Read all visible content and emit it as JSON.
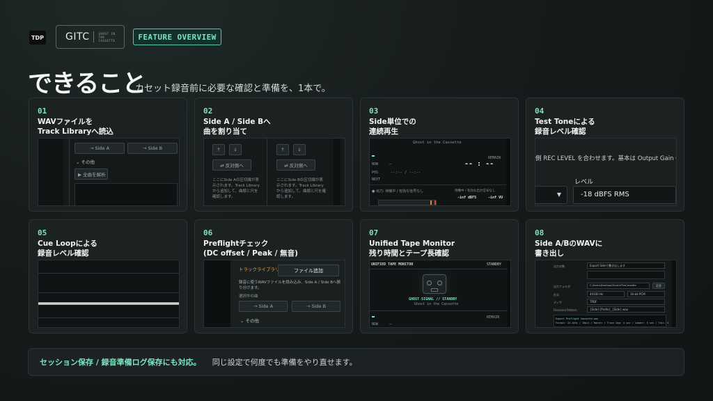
{
  "header": {
    "tdp": "TDP",
    "logo_name": "GITC",
    "logo_sub": "GHOST IN THE CASSETTE",
    "badge": "FEATURE OVERVIEW",
    "title": "できること",
    "subtitle": "カセット録音前に必要な確認と準備を、1本で。"
  },
  "cards": [
    {
      "num": "01",
      "title1": "WAVファイルを",
      "title2": "Track Libraryへ読込",
      "shot": {
        "side_a": "→ Side A",
        "side_b": "→ Side B",
        "other": "その他",
        "undo": "▶ 全曲を解析"
      }
    },
    {
      "num": "02",
      "title1": "Side A / Side Bへ",
      "title2": "曲を割り当て",
      "shot": {
        "up": "↑",
        "down": "↓",
        "swap": "⇄ 反対側へ",
        "desc_a": "ここにSide Aの区切線が表示されます。Track Libraryから追加して、曲順と尺を確認します。",
        "desc_b": "ここにSide Bの区切線が表示されます。Track Libraryから追加して、曲順と尺を確認します。"
      }
    },
    {
      "num": "03",
      "title1": "Side単位での",
      "title2": "連続再生",
      "shot": {
        "ghost": "Ghost in the Cassette",
        "remain": "REMAIN",
        "now": "NOW",
        "pos": "POS",
        "next": "NEXT",
        "time": "--:-- / --:--",
        "bigtime": "-- : --",
        "out": "出力: 待機中 / 有効な信号なし",
        "meter": "待機中 / 有効な出力信号なし",
        "db1": "-inf dBFS",
        "db2": "-inf VU"
      }
    },
    {
      "num": "04",
      "title1": "Test Toneによる",
      "title2": "録音レベル確認",
      "shot": {
        "hint": "側 REC LEVEL を合わせます。基本は Output Gain 0",
        "level_label": "レベル",
        "level_value": "-18 dBFS RMS"
      }
    },
    {
      "num": "05",
      "title1": "Cue Loopによる",
      "title2": "録音レベル確認",
      "shot": {}
    },
    {
      "num": "06",
      "title1": "Preflightチェック",
      "title2": "(DC offset / Peak / 無音)",
      "shot": {
        "lib": "トラックライブラリ",
        "add": "ファイル追加",
        "desc": "録音に使うWAVファイルを読み込み、Side A / Side Bへ振り分けます。",
        "mid": "選択中の曲",
        "side_a": "→ Side A",
        "side_b": "→ Side B",
        "other": "その他"
      }
    },
    {
      "num": "07",
      "title1": "Unified Tape Monitor",
      "title2": "残り時間とテープ長確認",
      "shot": {
        "label": "UNIFIED TAPE MONITOR",
        "standby": "STANDBY",
        "signal": "GHOST SIGNAL // STANDBY",
        "sub": "Ghost in the Cassette",
        "now": "NOW",
        "remain": "REMAIN"
      }
    },
    {
      "num": "08",
      "title1": "Side A/BのWAVに",
      "title2": "書き出し",
      "shot": {
        "target": "出力対象",
        "opt": "Export Sideで書き出します",
        "folder": "出力フォルダ",
        "path": "C:\\Users\\Desktop\\GhostInTheCassette",
        "change": "変更",
        "fmt": "形式",
        "sr": "44100 Hz",
        "bits": "16-bit PCM",
        "dither": "ディザ",
        "tpdf": "TPDF",
        "filename": "Filename Pattern",
        "pattern": "{Side}{Prefix}_{Side}.wav",
        "log1": "Export Preflight Cassette.wav",
        "log2": "Format: 44.1kHz / 16bit / Master / Track Gap: 4 sec / Leader: 5 sec / Tail: 5"
      }
    }
  ],
  "footer": {
    "highlight": "セッション保存 / 録音準備ログ保存にも対応。",
    "text": "同じ設定で何度でも準備をやり直せます。"
  }
}
